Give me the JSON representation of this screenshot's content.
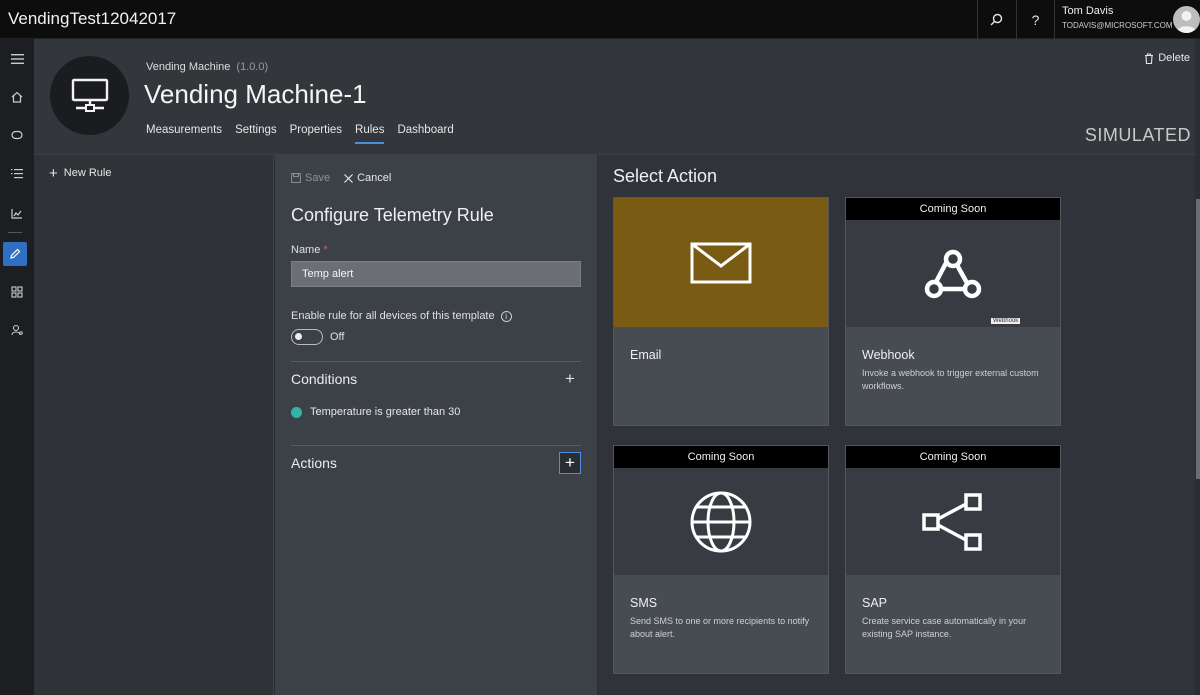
{
  "topbar": {
    "app_title": "VendingTest12042017",
    "user_name": "Tom Davis",
    "user_email": "TODAVIS@MICROSOFT.COM"
  },
  "header": {
    "crumb": "Vending Machine",
    "version": "(1.0.0)",
    "title": "Vending Machine-1",
    "tabs": [
      {
        "label": "Measurements"
      },
      {
        "label": "Settings"
      },
      {
        "label": "Properties"
      },
      {
        "label": "Rules"
      },
      {
        "label": "Dashboard"
      }
    ],
    "active_tab": "Rules",
    "delete_label": "Delete",
    "status": "SIMULATED"
  },
  "rules_list": {
    "new_rule_label": "New Rule"
  },
  "config": {
    "save_label": "Save",
    "cancel_label": "Cancel",
    "title": "Configure Telemetry Rule",
    "name_label": "Name",
    "required_mark": "*",
    "name_value": "Temp alert",
    "enable_label": "Enable rule for all devices of this template",
    "toggle_state": "Off",
    "conditions_title": "Conditions",
    "condition_text": "Temperature is greater than 30",
    "actions_title": "Actions"
  },
  "select_action": {
    "title": "Select Action",
    "cards": [
      {
        "title": "Email",
        "desc": "",
        "badge": ""
      },
      {
        "title": "Webhook",
        "desc": "Invoke a webhook to trigger external custom workflows.",
        "badge": "Coming Soon",
        "tag": "Webhook"
      },
      {
        "title": "SMS",
        "desc": "Send SMS to one or more recipients to notify about alert.",
        "badge": "Coming Soon"
      },
      {
        "title": "SAP",
        "desc": "Create service case automatically in your existing SAP instance.",
        "badge": "Coming Soon"
      }
    ]
  },
  "colors": {
    "accent": "#2f6fc4",
    "email_tile": "#7a5b14",
    "condition_dot": "#2fb5a8"
  }
}
